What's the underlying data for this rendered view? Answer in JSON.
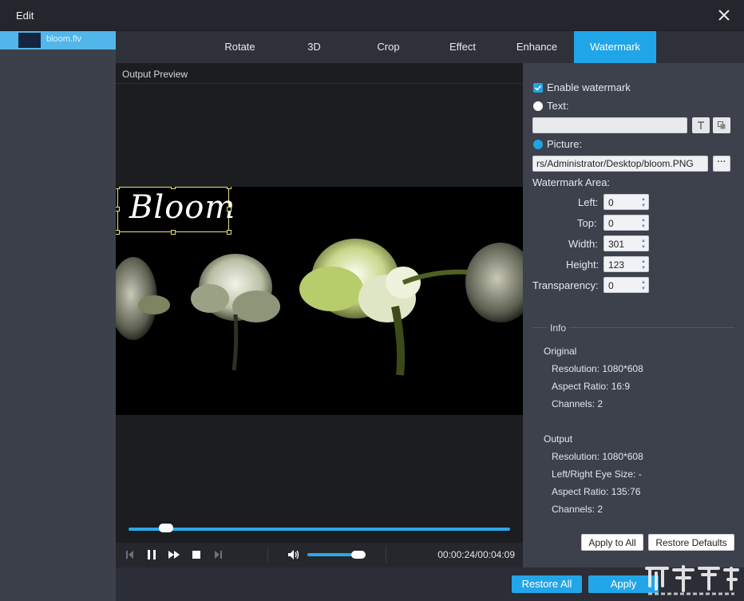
{
  "window": {
    "title": "Edit"
  },
  "file": {
    "name": "bloom.flv"
  },
  "tabs": [
    {
      "label": "Rotate"
    },
    {
      "label": "3D"
    },
    {
      "label": "Crop"
    },
    {
      "label": "Effect"
    },
    {
      "label": "Enhance"
    },
    {
      "label": "Watermark",
      "active": true
    }
  ],
  "preview": {
    "label": "Output Preview",
    "watermark_text": "Bloom",
    "seek_progress": 0.098,
    "volume_level": 0.9,
    "timecode": "00:00:24/00:04:09"
  },
  "watermark": {
    "enable_label": "Enable watermark",
    "enable_checked": true,
    "text_label": "Text:",
    "text_value": "",
    "picture_label": "Picture:",
    "picture_path": "rs/Administrator/Desktop/bloom.PNG",
    "browse_label": "···",
    "area_label": "Watermark Area:",
    "fields": [
      {
        "label": "Left:",
        "value": "0"
      },
      {
        "label": "Top:",
        "value": "0"
      },
      {
        "label": "Width:",
        "value": "301"
      },
      {
        "label": "Height:",
        "value": "123"
      },
      {
        "label": "Transparency:",
        "value": "0"
      }
    ]
  },
  "info": {
    "heading": "Info",
    "original_heading": "Original",
    "original": [
      "Resolution: 1080*608",
      "Aspect Ratio: 16:9",
      "Channels: 2"
    ],
    "output_heading": "Output",
    "output": [
      "Resolution: 1080*608",
      "Left/Right Eye Size: -",
      "Aspect Ratio: 135:76",
      "Channels: 2"
    ]
  },
  "buttons": {
    "apply_to_all": "Apply to All",
    "restore_defaults": "Restore Defaults",
    "restore_all": "Restore All",
    "apply": "Apply"
  },
  "colors": {
    "accent": "#20a6e8",
    "panel": "#3d414c",
    "sidebar": "#3c404b"
  }
}
